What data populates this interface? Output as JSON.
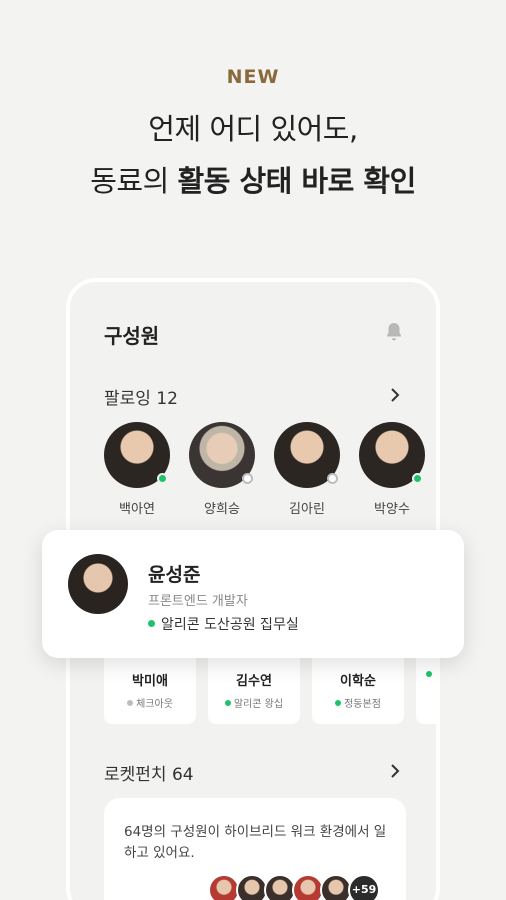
{
  "hero": {
    "badge": "NEW",
    "line1": "언제 어디 있어도,",
    "line2_prefix": "동료의 ",
    "line2_bold": "활동 상태 바로 확인"
  },
  "screen": {
    "title": "구성원",
    "following": {
      "label": "팔로잉 12",
      "people": [
        {
          "name": "백아연",
          "status": "online"
        },
        {
          "name": "양희승",
          "status": "offline"
        },
        {
          "name": "김아린",
          "status": "offline"
        },
        {
          "name": "박양수",
          "status": "online"
        }
      ]
    },
    "tiles": [
      {
        "name": "박미애",
        "status": "체크아웃",
        "dot_color": "#bdbdbd"
      },
      {
        "name": "김수연",
        "status": "알리콘 왕십",
        "dot_color": "#1ec26b"
      },
      {
        "name": "이학순",
        "status": "정동본점",
        "dot_color": "#1ec26b"
      },
      {
        "name": "",
        "status": "",
        "dot_color": "#1ec26b"
      }
    ],
    "rocketpunch": {
      "label": "로켓펀치 64",
      "description": "64명의 구성원이 하이브리드 워크 환경에서 일하고 있어요.",
      "more_count": "+59"
    }
  },
  "profile_card": {
    "name": "윤성준",
    "role": "프론트엔드 개발자",
    "location": "알리콘 도산공원 집무실",
    "status_color": "#1ec26b"
  },
  "colors": {
    "accent": "#8a6a3c",
    "online": "#1ec26b"
  },
  "icons": {
    "bell": "bell-icon",
    "chevron": "chevron-right-icon"
  }
}
